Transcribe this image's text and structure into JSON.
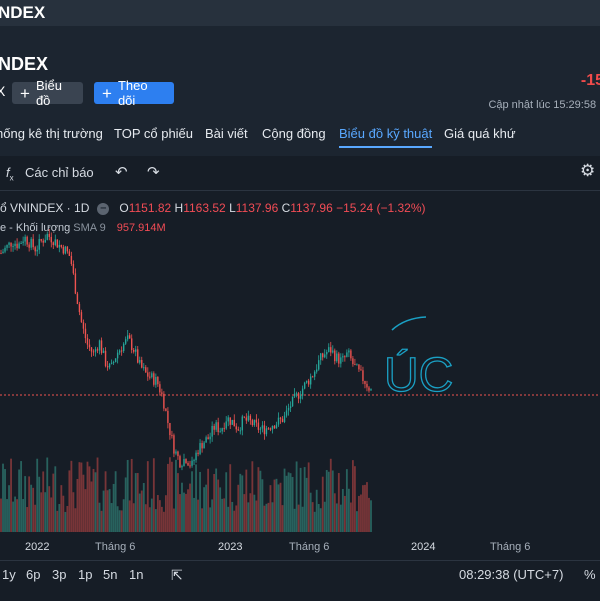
{
  "topbar": {
    "title": "NDEX"
  },
  "header": {
    "title": "NDEX",
    "change": "-15",
    "update": "Cập nhật lúc  15:29:58 |",
    "x_label": "X",
    "btn_chart": "Biểu đồ",
    "btn_follow": "Theo dõi"
  },
  "tabs": [
    "hống kê thị trường",
    "TOP cổ phiếu",
    "Bài viết",
    "Cộng đồng",
    "Biểu đồ kỹ thuật",
    "Giá quá khứ"
  ],
  "toolbar": {
    "indicators": "Các chỉ báo",
    "fx_icon": "fx",
    "undo_icon": "undo",
    "redo_icon": "redo",
    "gear_icon": "gear"
  },
  "legend": {
    "symbol": "ổ VNINDEX · 1D",
    "o_label": "O",
    "o": "1151.82",
    "h_label": "H",
    "h": "1163.52",
    "l_label": "L",
    "l": "1137.96",
    "c_label": "C",
    "c": "1137.96",
    "chg": "−15.24 (−1.32%)",
    "vol_label": "e - Khối lượng",
    "sma": "SMA 9",
    "vol": "957.914M"
  },
  "handwriting": "ÚC",
  "xaxis": {
    "y2022": "2022",
    "m6a": "Tháng 6",
    "y2023": "2023",
    "m6b": "Tháng 6",
    "y2024": "2024",
    "m6c": "Tháng 6"
  },
  "bottombar": {
    "r1y": "1y",
    "r6p": "6p",
    "r3p": "3p",
    "r1p": "1p",
    "r5n": "5n",
    "r1n": "1n",
    "time": "08:29:38 (UTC+7)",
    "pct": "%"
  },
  "colors": {
    "up": "#26a69a",
    "down": "#ef5350",
    "accent": "#59a8ff",
    "handwriting": "#1aa0c4"
  },
  "chart_data": {
    "type": "candlestick",
    "price_series": [
      1480,
      1495,
      1510,
      1500,
      1520,
      1505,
      1490,
      1510,
      1525,
      1515,
      1500,
      1490,
      1470,
      1380,
      1300,
      1250,
      1230,
      1260,
      1210,
      1190,
      1230,
      1250,
      1265,
      1240,
      1200,
      1180,
      1170,
      1160,
      1120,
      1050,
      990,
      960,
      970,
      950,
      990,
      1010,
      1020,
      1050,
      1040,
      1070,
      1060,
      1045,
      1065,
      1060,
      1050,
      1040,
      1045,
      1055,
      1060,
      1070,
      1100,
      1120,
      1140,
      1160,
      1180,
      1210,
      1230,
      1240,
      1220,
      1210,
      1230,
      1200,
      1180,
      1160,
      1138
    ],
    "last_close": 1137.96
  }
}
